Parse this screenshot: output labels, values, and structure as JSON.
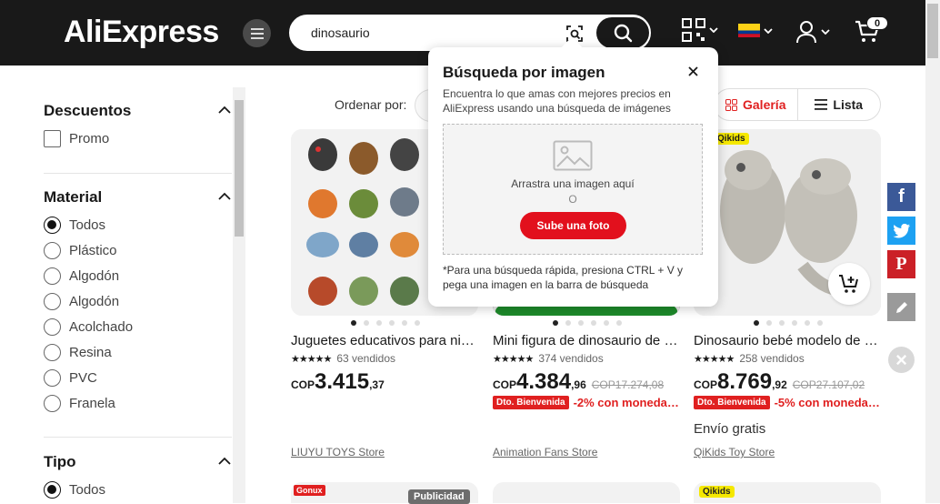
{
  "header": {
    "logo": "AliExpress",
    "search_value": "dinosaurio",
    "cart_count": "0",
    "icons": [
      "menu-icon",
      "camera-search-icon",
      "search-icon",
      "qr-code-icon",
      "flag-icon",
      "user-icon",
      "cart-icon"
    ]
  },
  "sidebar": {
    "descuentos": {
      "title": "Descuentos",
      "items": [
        "Promo"
      ]
    },
    "material": {
      "title": "Material",
      "items": [
        "Todos",
        "Plástico",
        "Algodón",
        "Algodón",
        "Acolchado",
        "Resina",
        "PVC",
        "Franela"
      ],
      "selected": "Todos"
    },
    "tipo": {
      "title": "Tipo",
      "items": [
        "Todos"
      ],
      "selected": "Todos"
    }
  },
  "toolbar": {
    "sort_label": "Ordenar por:",
    "view_gallery": "Galería",
    "view_list": "Lista"
  },
  "products": [
    {
      "title": "Juguetes educativos para niño…",
      "rating_stars": "★★★★★",
      "sold": "63 vendidos",
      "currency": "COP",
      "price_int": "3.415",
      "price_dec": ",37",
      "old_price": "",
      "promo_badge": "",
      "promo_text": "",
      "shipping": "",
      "store": "LIUYU TOYS Store"
    },
    {
      "title": "Mini figura de dinosaurio de g…",
      "rating_stars": "★★★★★",
      "sold": "374 vendidos",
      "currency": "COP",
      "price_int": "4.384",
      "price_dec": ",96",
      "old_price": "COP17.274,08",
      "promo_badge": "Dto. Bienvenida",
      "promo_text": "-2% con moneda…",
      "shipping": "",
      "store": "Animation Fans Store"
    },
    {
      "title": "Dinosaurio bebé modelo de si…",
      "rating_stars": "★★★★★",
      "sold": "258 vendidos",
      "currency": "COP",
      "price_int": "8.769",
      "price_dec": ",92",
      "old_price": "COP27.107,02",
      "promo_badge": "Dto. Bienvenida",
      "promo_text": "-5% con moneda…",
      "shipping": "Envío gratis",
      "store": "QiKids Toy Store",
      "tag": "Qikids"
    }
  ],
  "row2_tags": {
    "left": "Gonux",
    "ad": "Publicidad",
    "right": "Qikids"
  },
  "popup": {
    "title": "Búsqueda por imagen",
    "description": "Encuentra lo que amas con mejores precios en AliExpress usando una búsqueda de imágenes",
    "drop_text": "Arrastra una imagen aquí",
    "or_text": "O",
    "upload_button": "Sube una foto",
    "footer": "*Para una búsqueda rápida, presiona CTRL + V y pega una imagen en la barra de búsqueda"
  },
  "colors": {
    "header_bg": "#191919",
    "accent_red": "#e02020",
    "facebook": "#3b5998",
    "twitter": "#1da1f2",
    "pinterest": "#cb2027"
  }
}
